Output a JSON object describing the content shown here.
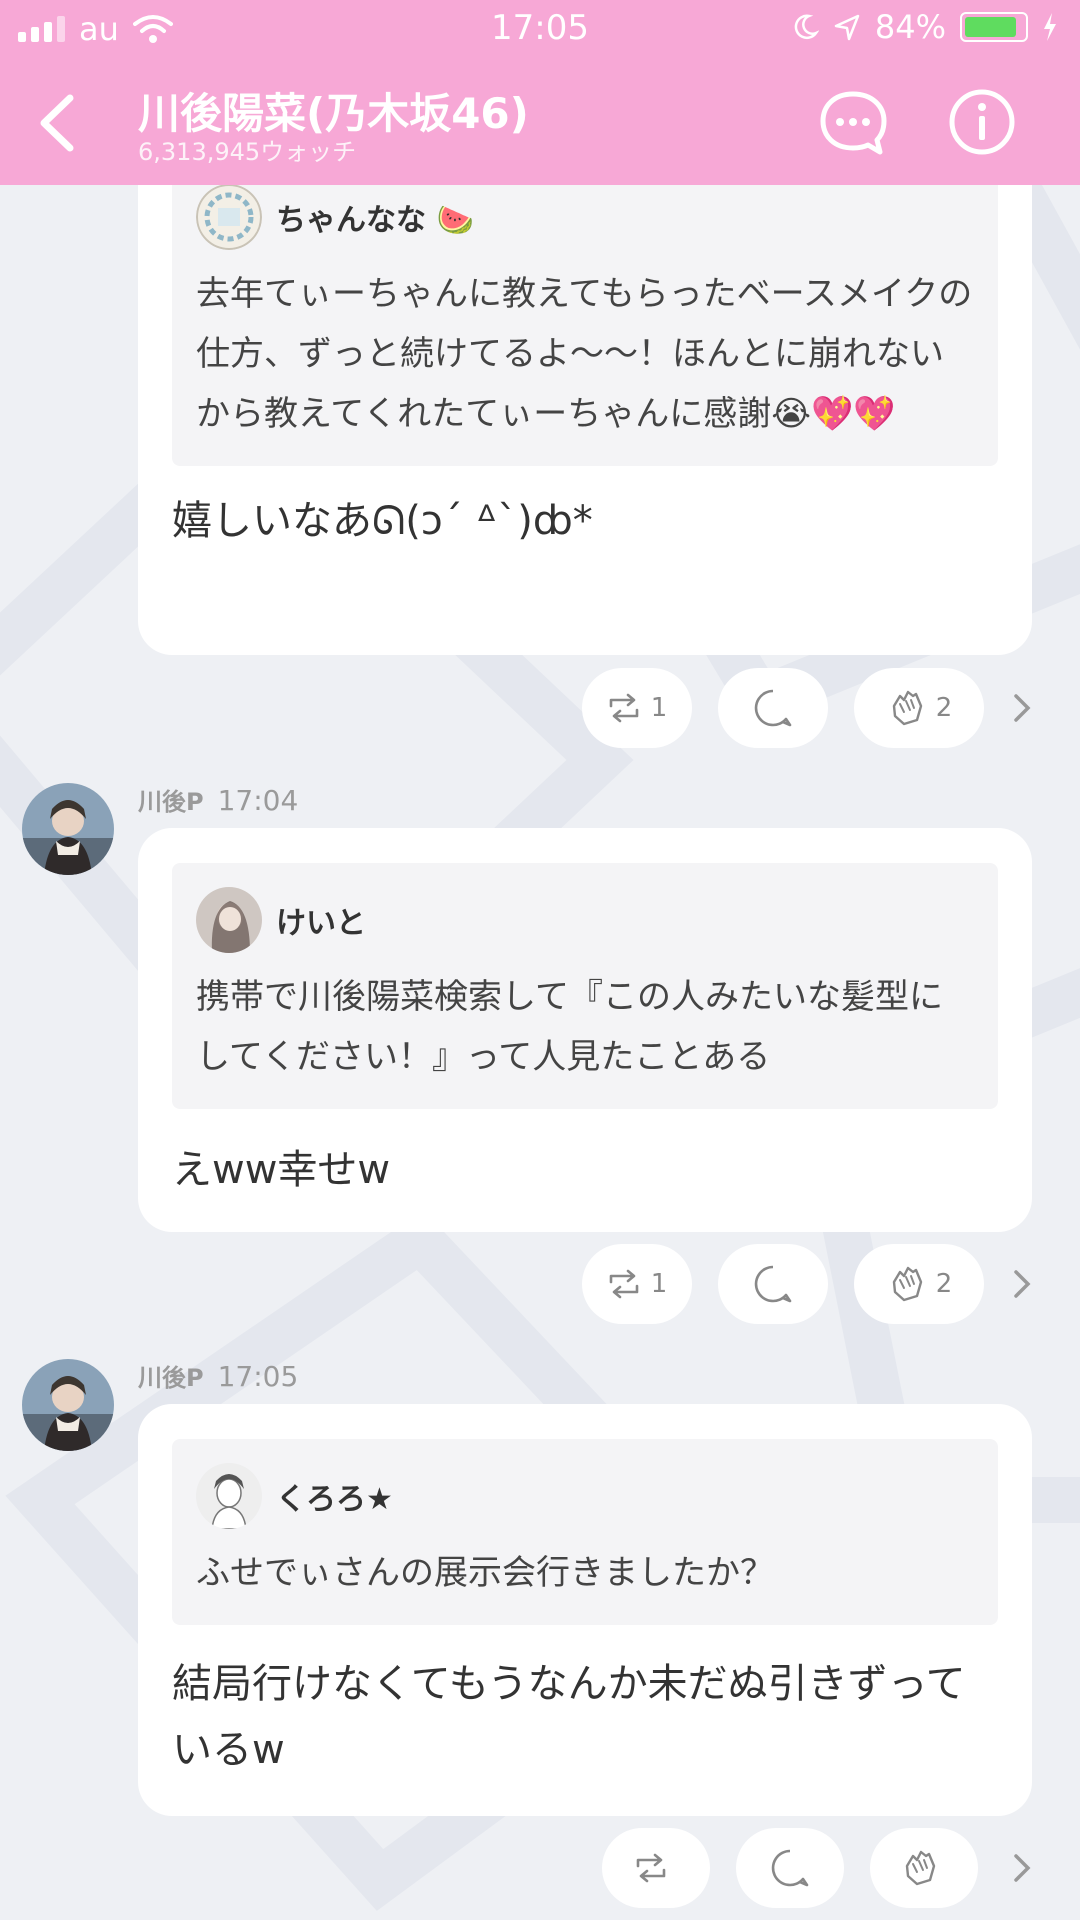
{
  "status_bar": {
    "carrier": "au",
    "time": "17:05",
    "battery": "84%"
  },
  "header": {
    "title": "川後陽菜(乃木坂46)",
    "subtitle": "6,313,945ウォッチ"
  },
  "posts": [
    {
      "quote": {
        "name": "ちゃんなな 🍉",
        "text": "去年てぃーちゃんに教えてもらったベースメイクの仕方、ずっと続けてるよ〜〜！ほんとに崩れないから教えてくれたてぃーちゃんに感謝😭💖💖"
      },
      "reply": "嬉しいなあᘏ(ɔ´ ᐞ`)ȸ*",
      "actions": {
        "repost_count": "1",
        "clap_count": "2"
      }
    },
    {
      "author": "川後P",
      "time": "17:04",
      "quote": {
        "name": "けいと",
        "text": "携帯で川後陽菜検索して『この人みたいな髪型にしてください！』って人見たことある"
      },
      "reply": "えww幸せw",
      "actions": {
        "repost_count": "1",
        "clap_count": "2"
      }
    },
    {
      "author": "川後P",
      "time": "17:05",
      "quote": {
        "name": "くろろ★",
        "text": "ふせでぃさんの展示会行きましたか？"
      },
      "reply": "結局行けなくてもうなんか未だぬ引きずっているw",
      "actions": {
        "repost_count": "",
        "clap_count": ""
      }
    }
  ],
  "colors": {
    "header_pink": "#f7a8d6",
    "background": "#eef0f4"
  },
  "icons": [
    "back-arrow-icon",
    "chat-bubble-icon",
    "info-icon",
    "repost-icon",
    "comment-icon",
    "clap-icon",
    "chevron-right-icon"
  ]
}
